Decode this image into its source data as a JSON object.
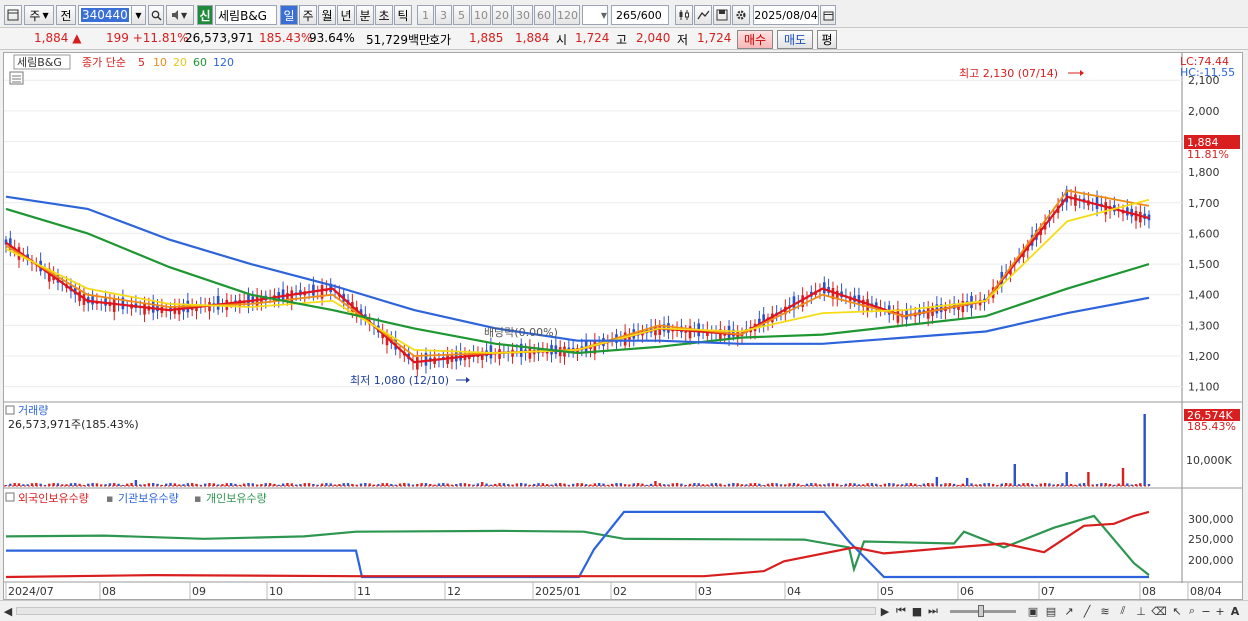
{
  "toolbar": {
    "market_label": "주",
    "prev_label": "전",
    "stock_code": "340440",
    "badge_new": "신",
    "stock_name": "세림B&G",
    "period_tabs": [
      "일",
      "주",
      "월",
      "년",
      "분",
      "초",
      "틱"
    ],
    "active_period": "일",
    "interval_buttons": [
      "1",
      "3",
      "5",
      "10",
      "20",
      "30",
      "60",
      "120"
    ],
    "count_value": "265",
    "count_total": "/600",
    "date_value": "2025/08/04"
  },
  "quote": {
    "price": "1,884",
    "change": "199",
    "change_rate": "+11.81%",
    "volume": "26,573,971",
    "volume_ratio": "185.43%",
    "turnover": "93.64%",
    "amount": "51,729백만",
    "hoga_label": "호가",
    "ask": "1,885",
    "bid": "1,884",
    "open_label": "시",
    "open": "1,724",
    "high_label": "고",
    "high": "2,040",
    "low_label": "저",
    "low": "1,724",
    "buy_button": "매수",
    "sell_button": "매도",
    "avg_button": "평"
  },
  "price_panel": {
    "stock_label": "세림B&G",
    "ma_title": "종가 단순",
    "ma_periods": [
      {
        "label": "5",
        "color": "#e0141e"
      },
      {
        "label": "10",
        "color": "#f08c14"
      },
      {
        "label": "20",
        "color": "#f5dc14"
      },
      {
        "label": "60",
        "color": "#1e9632"
      },
      {
        "label": "120",
        "color": "#2d64dc"
      }
    ],
    "lc_label": "LC:74.44",
    "hc_label": "HC:-11.55",
    "high_annotation": "최고 2,130 (07/14)",
    "low_annotation": "최저 1,080 (12/10)",
    "dividend_annotation": "배당락(0.00%)",
    "current_price_tag": "1,884",
    "current_rate_tag": "11.81%"
  },
  "volume_panel": {
    "title": "거래량",
    "value_text": "26,573,971주(185.43%)",
    "current_tag": "26,574K",
    "current_rate": "185.43%",
    "axis_label": "10,000K"
  },
  "holding_panel": {
    "series": [
      {
        "name": "외국인보유수량",
        "color": "#d81e1e"
      },
      {
        "name": "기관보유수량",
        "color": "#2d64dc"
      },
      {
        "name": "개인보유수량",
        "color": "#2d9650"
      }
    ],
    "axis_labels": [
      "300,000",
      "250,000",
      "200,000"
    ]
  },
  "x_axis": {
    "labels": [
      "2024/07",
      "08",
      "09",
      "10",
      "11",
      "12",
      "2025/01",
      "02",
      "03",
      "04",
      "05",
      "06",
      "07",
      "08",
      "08/04"
    ]
  },
  "chart_data": {
    "type": "line",
    "title": "",
    "xlabel": "",
    "ylabel": "",
    "x": [
      "2024/07",
      "08",
      "09",
      "10",
      "11",
      "12",
      "2025/01",
      "02",
      "03",
      "04",
      "05",
      "06",
      "07",
      "08"
    ],
    "ylim": [
      1050,
      2130
    ],
    "y_ticks": [
      "1,100",
      "1,200",
      "1,300",
      "1,400",
      "1,500",
      "1,600",
      "1,700",
      "1,800",
      "1,900",
      "2,000",
      "2,100"
    ],
    "series": [
      {
        "name": "5",
        "values": [
          1570,
          1380,
          1350,
          1380,
          1420,
          1180,
          1210,
          1220,
          1290,
          1270,
          1420,
          1330,
          1380,
          1720,
          1650
        ]
      },
      {
        "name": "10",
        "values": [
          1560,
          1400,
          1360,
          1370,
          1400,
          1200,
          1210,
          1220,
          1300,
          1270,
          1400,
          1330,
          1380,
          1740,
          1690
        ]
      },
      {
        "name": "20",
        "values": [
          1550,
          1420,
          1370,
          1360,
          1380,
          1220,
          1210,
          1220,
          1290,
          1280,
          1340,
          1350,
          1380,
          1640,
          1710
        ]
      },
      {
        "name": "60",
        "values": [
          1680,
          1600,
          1490,
          1400,
          1350,
          1290,
          1240,
          1210,
          1230,
          1260,
          1270,
          1300,
          1330,
          1420,
          1500
        ]
      },
      {
        "name": "120",
        "values": [
          1720,
          1680,
          1580,
          1500,
          1430,
          1350,
          1290,
          1250,
          1250,
          1240,
          1240,
          1260,
          1280,
          1340,
          1390
        ]
      }
    ]
  }
}
